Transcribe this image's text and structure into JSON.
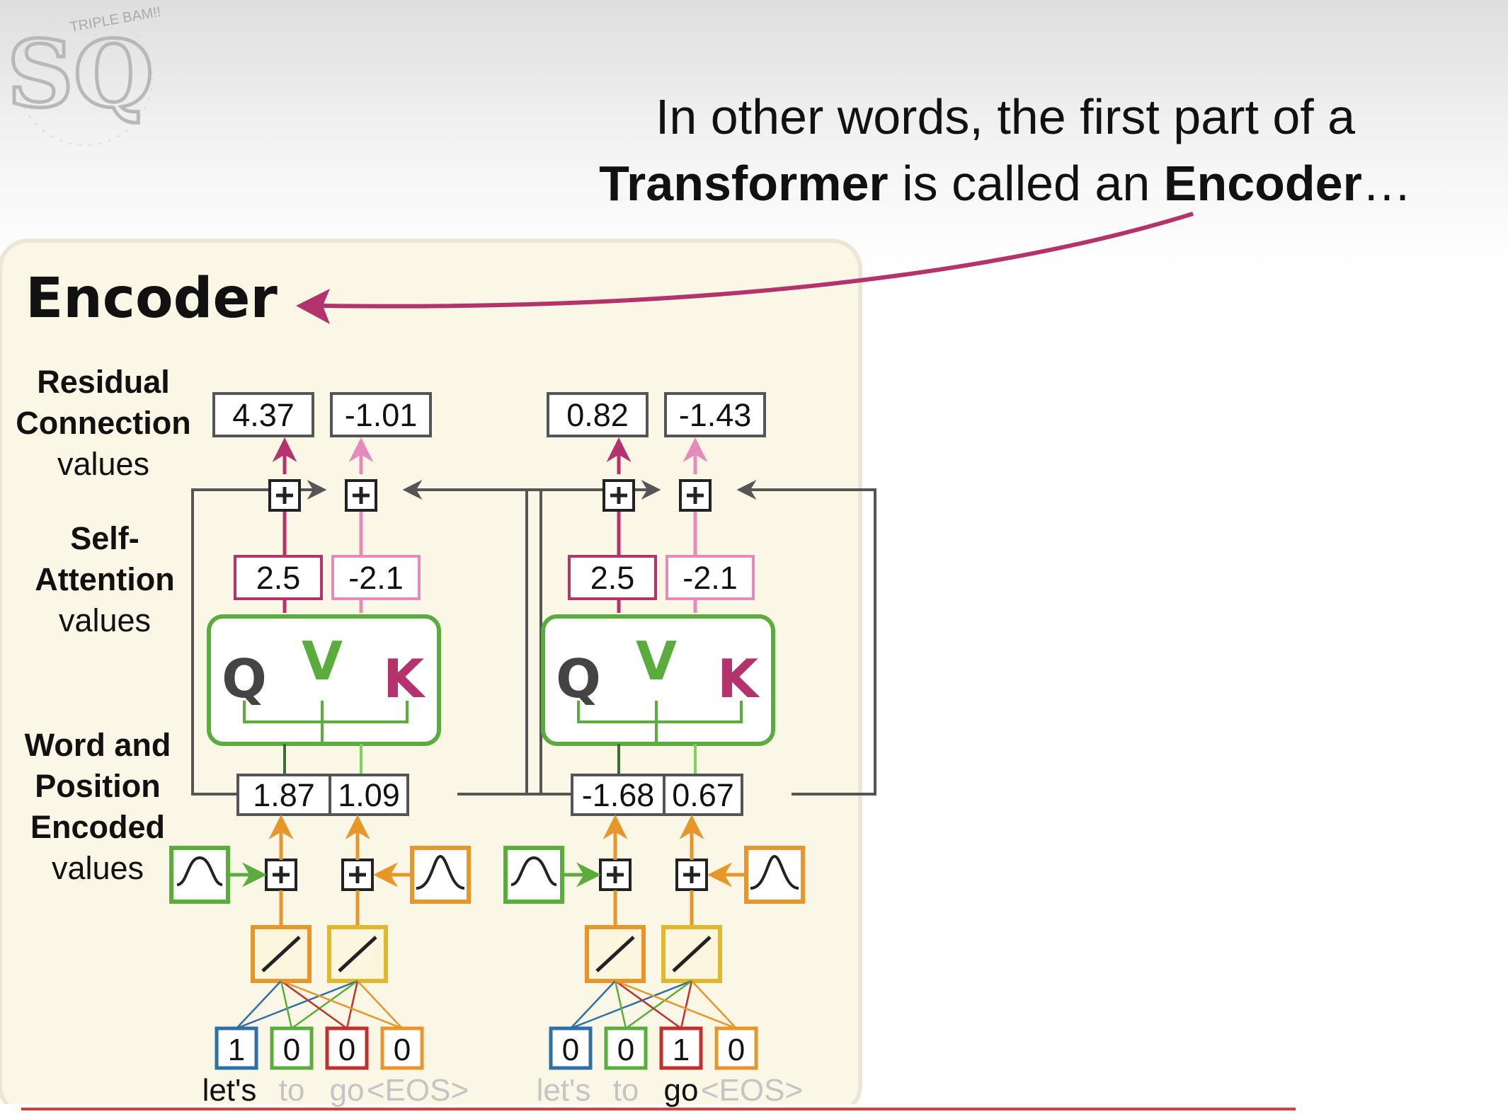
{
  "caption": {
    "line1": "In other words, the first part of a",
    "line2_bold1": "Transformer",
    "line2_mid": " is called an ",
    "line2_bold2": "Encoder",
    "line2_end": "…"
  },
  "logo": {
    "letters": "SQ",
    "small_text": "TRIPLE BAM!!"
  },
  "encoder_title": "Encoder",
  "row_labels": {
    "residual": [
      "Residual",
      "Connection",
      "values"
    ],
    "self_attention": [
      "Self-",
      "Attention",
      "values"
    ],
    "word_position": [
      "Word and",
      "Position",
      "Encoded",
      "values"
    ]
  },
  "qvk_letters": [
    "Q",
    "V",
    "K"
  ],
  "left_block": {
    "residual_values": [
      "4.37",
      "-1.01"
    ],
    "attention_values": [
      "2.5",
      "-2.1"
    ],
    "encoded_values": [
      "1.87",
      "1.09"
    ],
    "one_hot": [
      "1",
      "0",
      "0",
      "0"
    ],
    "words": [
      "let's",
      "to",
      "go",
      "<EOS>"
    ],
    "active_word": "let's"
  },
  "right_block": {
    "residual_values": [
      "0.82",
      "-1.43"
    ],
    "attention_values": [
      "2.5",
      "-2.1"
    ],
    "encoded_values": [
      "-1.68",
      "0.67"
    ],
    "one_hot": [
      "0",
      "0",
      "1",
      "0"
    ],
    "words": [
      "let's",
      "to",
      "go",
      "<EOS>"
    ],
    "active_word": "go"
  },
  "colors": {
    "magenta": "#b5336c",
    "pink": "#e48bbb",
    "green": "#5aad3c",
    "orange": "#e8952a",
    "blue": "#2e6fa8",
    "red": "#c0302d",
    "gray": "#555555"
  }
}
